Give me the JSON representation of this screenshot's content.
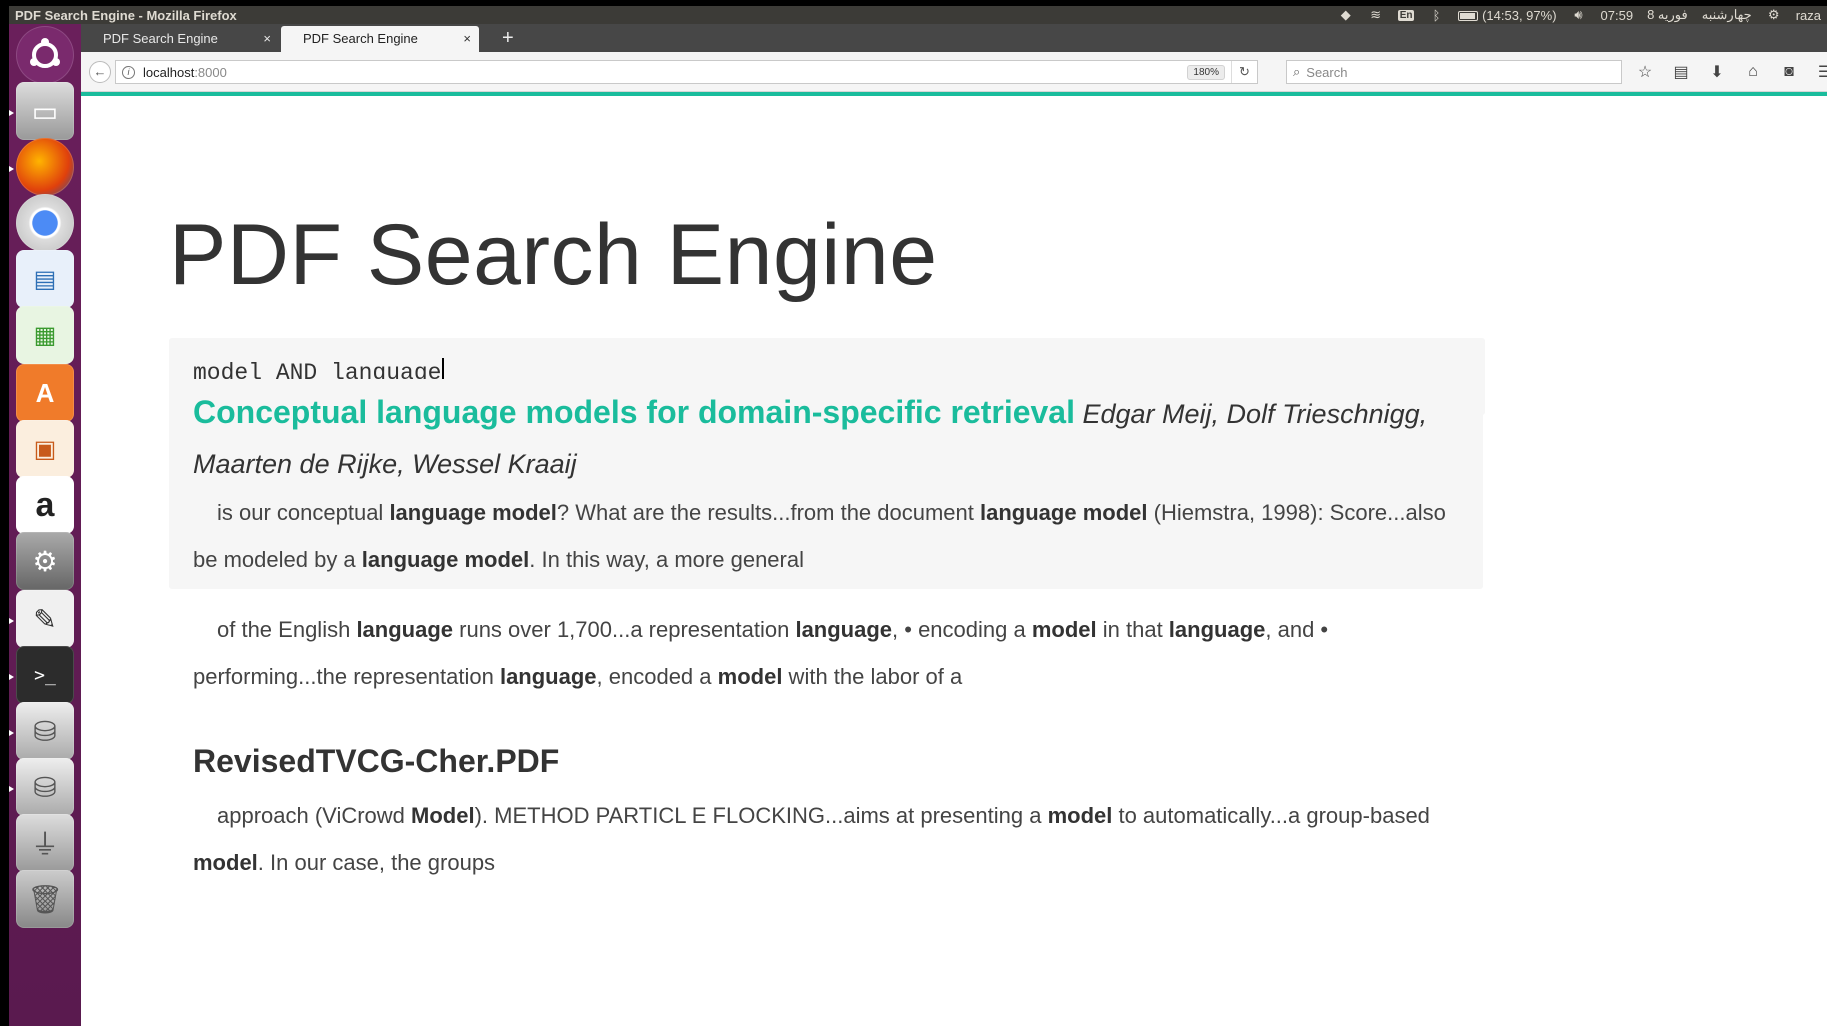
{
  "panel": {
    "window_title": "PDF Search Engine - Mozilla Firefox",
    "battery": "(14:53, 97%)",
    "keyboard": "En",
    "time": "07:59",
    "date": "8 فوریه",
    "day": "چهارشنبه",
    "user": "raza"
  },
  "browser": {
    "tabs": [
      {
        "label": "PDF Search Engine",
        "close": "×"
      },
      {
        "label": "PDF Search Engine",
        "close": "×"
      }
    ],
    "new_tab": "+",
    "url_host": "localhost",
    "url_port": ":8000",
    "zoom": "180%",
    "search_placeholder": "Search"
  },
  "page": {
    "title": "PDF Search Engine",
    "query": "model AND language",
    "results": [
      {
        "title": "Conceptual language models for domain-specific retrieval",
        "authors": "Edgar Meij, Dolf Trieschnigg, Maarten de Rijke, Wessel Kraaij",
        "snippet": [
          {
            "t": "is our conceptual ",
            "b": false
          },
          {
            "t": "language model",
            "b": true
          },
          {
            "t": "? What are the results...from the document ",
            "b": false
          },
          {
            "t": "language model",
            "b": true
          },
          {
            "t": " (Hiemstra, 1998): Score...also be modeled by a ",
            "b": false
          },
          {
            "t": "language model",
            "b": true
          },
          {
            "t": ". In this way, a more general",
            "b": false
          }
        ]
      },
      {
        "title": "",
        "authors": "",
        "snippet": [
          {
            "t": "of the English ",
            "b": false
          },
          {
            "t": "language",
            "b": true
          },
          {
            "t": " runs over 1,700...a representation ",
            "b": false
          },
          {
            "t": "language",
            "b": true
          },
          {
            "t": ", • encoding a ",
            "b": false
          },
          {
            "t": "model",
            "b": true
          },
          {
            "t": " in that ",
            "b": false
          },
          {
            "t": "language",
            "b": true
          },
          {
            "t": ", and • performing...the representation ",
            "b": false
          },
          {
            "t": "language",
            "b": true
          },
          {
            "t": ", encoded a ",
            "b": false
          },
          {
            "t": "model",
            "b": true
          },
          {
            "t": " with the labor of a",
            "b": false
          }
        ]
      },
      {
        "title": "RevisedTVCG-Cher.PDF",
        "authors": "",
        "snippet": [
          {
            "t": "approach (ViCrowd ",
            "b": false
          },
          {
            "t": "Model",
            "b": true
          },
          {
            "t": "). METHOD PARTICL E FLOCKING...aims at presenting a ",
            "b": false
          },
          {
            "t": "model",
            "b": true
          },
          {
            "t": " to automatically...a group-based ",
            "b": false
          },
          {
            "t": "model",
            "b": true
          },
          {
            "t": ". In our case, the groups",
            "b": false
          }
        ]
      }
    ]
  },
  "colors": {
    "accent": "#1abc9c",
    "launcher": "#5e1b52",
    "panel": "#3c3b37"
  }
}
